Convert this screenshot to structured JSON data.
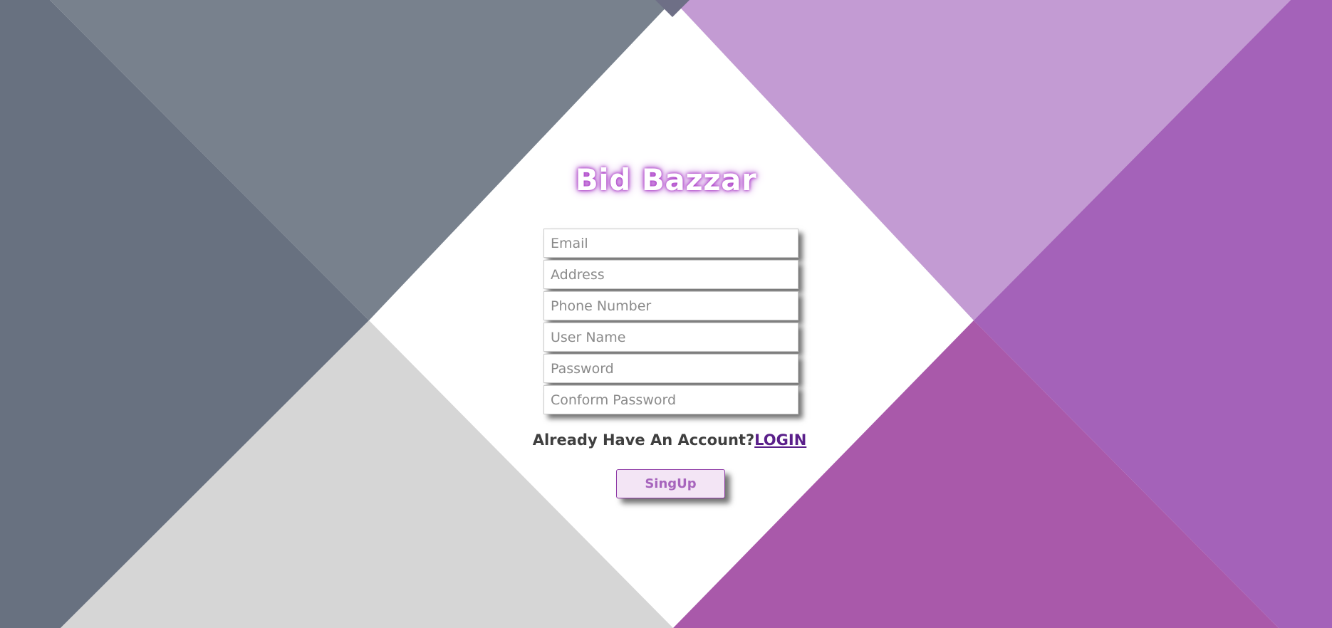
{
  "app": {
    "brand": "Bid Bazzar"
  },
  "form": {
    "email_placeholder": "Email",
    "address_placeholder": "Address",
    "phone_placeholder": "Phone Number",
    "username_placeholder": "User Name",
    "password_placeholder": "Password",
    "confirm_password_placeholder": "Conform Password"
  },
  "account": {
    "prompt": "Already Have An Account?",
    "login_label": "LOGIN"
  },
  "actions": {
    "signup_label": "SingUp"
  },
  "colors": {
    "slate_dark": "#687180",
    "slate_light": "#78818d",
    "light_gray": "#d6d6d6",
    "lilac": "#c39bd3",
    "purple": "#a462b9",
    "magenta": "#a959aa",
    "accent": "#5a1f8a"
  }
}
